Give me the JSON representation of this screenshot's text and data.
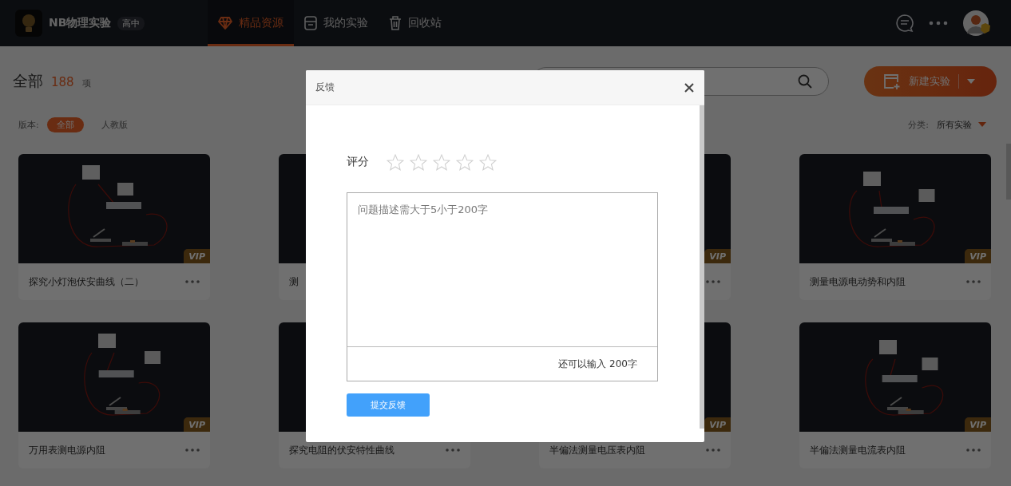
{
  "app": {
    "name": "NB物理实验",
    "badge": "高中"
  },
  "nav": [
    {
      "label": "精品资源",
      "selected": true
    },
    {
      "label": "我的实验",
      "selected": false
    },
    {
      "label": "回收站",
      "selected": false
    }
  ],
  "header": {
    "title": "全部",
    "count": "188",
    "unit": "项",
    "new_button": "新建实验"
  },
  "filters": {
    "edition_label": "版本:",
    "editions": [
      {
        "label": "全部",
        "selected": true
      },
      {
        "label": "人教版",
        "selected": false
      }
    ],
    "category_label": "分类:",
    "category": "所有实验"
  },
  "cards": [
    {
      "title": "探究小灯泡伏安曲线（二）",
      "badge": "VIP"
    },
    {
      "title": "测"
    },
    {
      "badge": "VIP"
    },
    {
      "title": "测量电源电动势和内阻",
      "badge": "VIP"
    },
    {
      "title": "万用表测电源内阻",
      "badge": "VIP"
    },
    {
      "title": "探究电阻的伏安特性曲线"
    },
    {
      "title": "半偏法测量电压表内阻",
      "badge": "VIP"
    },
    {
      "title": "半偏法测量电流表内阻",
      "badge": "VIP"
    }
  ],
  "dialog": {
    "title": "反馈",
    "rating_label": "评分",
    "stars": 0,
    "placeholder": "问题描述需大于5小于200字",
    "counter": "还可以输入 200字",
    "submit": "提交反馈"
  }
}
